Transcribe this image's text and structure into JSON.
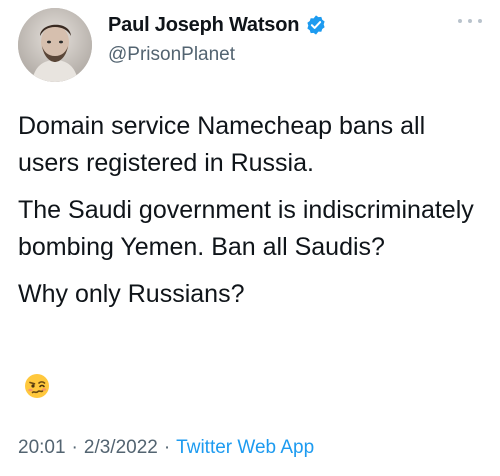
{
  "author": {
    "display_name": "Paul Joseph Watson",
    "handle": "@PrisonPlanet",
    "verified": true,
    "avatar_icon": "profile-photo",
    "verified_color": "#1d9bf0"
  },
  "tweet": {
    "paragraphs": [
      "Domain service Namecheap bans all users registered in Russia.",
      "The Saudi government is indiscriminately bombing Yemen. Ban all Saudis?",
      "Why only Russians?"
    ],
    "emoji_icon": "woozy-face-emoji"
  },
  "meta": {
    "time": "20:01",
    "separator": "·",
    "date": "2/3/2022",
    "source": "Twitter Web App",
    "source_color": "#1d9bf0"
  }
}
